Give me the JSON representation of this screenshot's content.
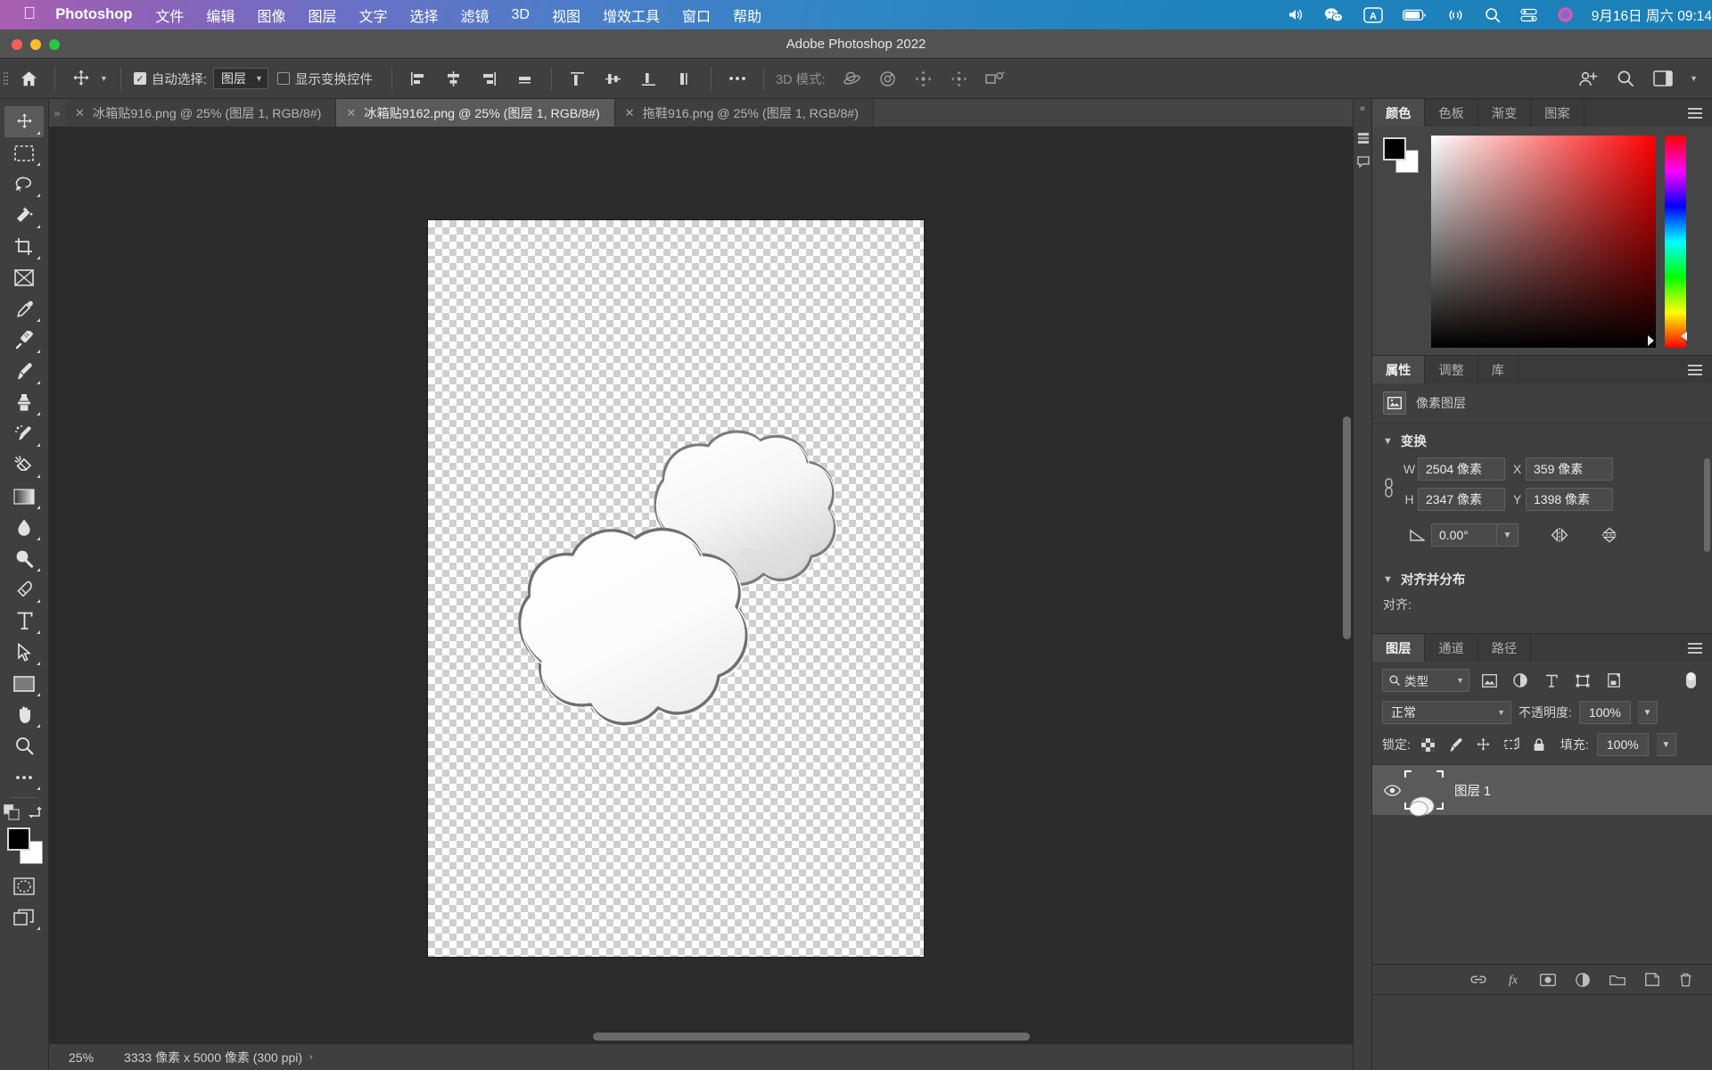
{
  "macbar": {
    "apple_icon": "apple-logo-icon",
    "app_name": "Photoshop",
    "menus": [
      "文件",
      "编辑",
      "图像",
      "图层",
      "文字",
      "选择",
      "滤镜",
      "3D",
      "视图",
      "增效工具",
      "窗口",
      "帮助"
    ],
    "tray_icons": [
      "volume-icon",
      "wechat-icon",
      "input-source-icon",
      "battery-icon",
      "link-icon",
      "search-icon",
      "control-center-icon",
      "siri-icon"
    ],
    "clock": "9月16日 周六 09:14"
  },
  "window": {
    "title": "Adobe Photoshop 2022",
    "traffic": {
      "close": "#ff5f57",
      "minimize": "#febc2e",
      "zoom": "#28c840"
    }
  },
  "options_bar": {
    "home_icon": "home-icon",
    "tool_icon": "move-tool-icon",
    "auto_select": {
      "checked": true,
      "label": "自动选择:",
      "value": "图层"
    },
    "show_transform": {
      "checked": false,
      "label": "显示变换控件"
    },
    "align_icons": [
      "align-left-icon",
      "align-horizontal-center-icon",
      "align-right-icon",
      "distribute-horizontal-icon",
      "align-top-icon",
      "align-vertical-center-icon",
      "align-bottom-icon",
      "distribute-vertical-icon"
    ],
    "more_icon": "more-options-icon",
    "mode3d_label": "3D 模式:",
    "mode3d_icons": [
      "orbit-3d-icon",
      "roll-3d-icon",
      "pan-3d-icon",
      "slide-3d-icon",
      "scale-3d-icon"
    ],
    "right_icons": [
      "share-icon",
      "search-icon",
      "workspace-icon",
      "chevron-down-icon"
    ]
  },
  "tabs": [
    {
      "label": "冰箱贴916.png @ 25% (图层 1, RGB/8#)",
      "active": false
    },
    {
      "label": "冰箱贴9162.png @ 25% (图层 1, RGB/8#)",
      "active": true
    },
    {
      "label": "拖鞋916.png @ 25% (图层 1, RGB/8#)",
      "active": false
    }
  ],
  "toolbar": {
    "tools": [
      {
        "name": "move-tool-icon",
        "selected": true,
        "arrow": true
      },
      {
        "name": "rectangular-marquee-tool-icon",
        "selected": false,
        "arrow": true
      },
      {
        "name": "lasso-tool-icon",
        "selected": false,
        "arrow": true
      },
      {
        "name": "magic-wand-tool-icon",
        "selected": false,
        "arrow": true
      },
      {
        "name": "crop-tool-icon",
        "selected": false,
        "arrow": true
      },
      {
        "name": "frame-tool-icon",
        "selected": false,
        "arrow": false
      },
      {
        "name": "eyedropper-tool-icon",
        "selected": false,
        "arrow": true
      },
      {
        "name": "spot-healing-brush-tool-icon",
        "selected": false,
        "arrow": true
      },
      {
        "name": "brush-tool-icon",
        "selected": false,
        "arrow": true
      },
      {
        "name": "clone-stamp-tool-icon",
        "selected": false,
        "arrow": true
      },
      {
        "name": "history-brush-tool-icon",
        "selected": false,
        "arrow": true
      },
      {
        "name": "eraser-tool-icon",
        "selected": false,
        "arrow": true
      },
      {
        "name": "gradient-tool-icon",
        "selected": false,
        "arrow": true
      },
      {
        "name": "blur-tool-icon",
        "selected": false,
        "arrow": true
      },
      {
        "name": "dodge-tool-icon",
        "selected": false,
        "arrow": true
      },
      {
        "name": "pen-tool-icon",
        "selected": false,
        "arrow": true
      },
      {
        "name": "type-tool-icon",
        "selected": false,
        "arrow": true
      },
      {
        "name": "path-selection-tool-icon",
        "selected": false,
        "arrow": true
      },
      {
        "name": "rectangle-tool-icon",
        "selected": false,
        "arrow": true
      },
      {
        "name": "hand-tool-icon",
        "selected": false,
        "arrow": true
      },
      {
        "name": "zoom-tool-icon",
        "selected": false,
        "arrow": false
      },
      {
        "name": "edit-toolbar-icon",
        "selected": false,
        "arrow": true
      }
    ],
    "swap_icons": [
      "default-colors-icon",
      "swap-colors-icon"
    ],
    "foreground_color": "#000000",
    "background_color": "#ffffff",
    "quick_mask_icon": "quick-mask-icon",
    "screen_mode_icon": "screen-mode-icon"
  },
  "status_bar": {
    "zoom": "25%",
    "doc_size": "3333 像素 x 5000 像素 (300 ppi)",
    "arrow": "›"
  },
  "dock": {
    "collapse_icon": "collapse-panels-icon",
    "rail_icons": [
      "history-panel-icon",
      "comments-panel-icon"
    ],
    "color_panel": {
      "tabs": [
        {
          "label": "颜色",
          "active": true
        },
        {
          "label": "色板",
          "active": false
        },
        {
          "label": "渐变",
          "active": false
        },
        {
          "label": "图案",
          "active": false
        }
      ],
      "menu_icon": "panel-menu-icon",
      "foreground_color": "#000000",
      "background_color": "#ffffff",
      "spectrum_hue": "#ff0000"
    },
    "properties_panel": {
      "tabs": [
        {
          "label": "属性",
          "active": true
        },
        {
          "label": "调整",
          "active": false
        },
        {
          "label": "库",
          "active": false
        }
      ],
      "menu_icon": "panel-menu-icon",
      "kind_icon": "pixel-layer-icon",
      "kind_label": "像素图层",
      "transform": {
        "section_label": "变换",
        "link_icon": "link-dimensions-icon",
        "w_label": "W",
        "w_value": "2504 像素",
        "x_label": "X",
        "x_value": "359 像素",
        "h_label": "H",
        "h_value": "2347 像素",
        "y_label": "Y",
        "y_value": "1398 像素",
        "angle_icon": "angle-icon",
        "angle_value": "0.00°",
        "flip_h_icon": "flip-horizontal-icon",
        "flip_v_icon": "flip-vertical-icon"
      },
      "align": {
        "section_label": "对齐并分布",
        "align_label": "对齐:"
      }
    },
    "layers_panel": {
      "tabs": [
        {
          "label": "图层",
          "active": true
        },
        {
          "label": "通道",
          "active": false
        },
        {
          "label": "路径",
          "active": false
        }
      ],
      "menu_icon": "panel-menu-icon",
      "filter": {
        "search_icon": "search-icon",
        "kind_label": "类型",
        "type_icons": [
          "filter-pixel-icon",
          "filter-adjustment-icon",
          "filter-type-icon",
          "filter-shape-icon",
          "filter-smart-object-icon"
        ],
        "toggle_icon": "filter-toggle-icon"
      },
      "blend_mode": "正常",
      "opacity_label": "不透明度:",
      "opacity_value": "100%",
      "lock_label": "锁定:",
      "lock_icons": [
        "lock-transparent-pixels-icon",
        "lock-image-pixels-icon",
        "lock-position-icon",
        "lock-artboard-nesting-icon",
        "lock-all-icon"
      ],
      "fill_label": "填充:",
      "fill_value": "100%",
      "layers": [
        {
          "name": "图层 1",
          "visible": true,
          "selected": true,
          "eye_icon": "eye-icon"
        }
      ],
      "footer_icons": [
        "link-layers-icon",
        "layer-style-icon",
        "layer-mask-icon",
        "adjustment-layer-icon",
        "new-group-icon",
        "new-layer-icon",
        "delete-layer-icon"
      ]
    }
  },
  "canvas": {
    "artwork_name": "cloud-shaped-fridge-magnet-artwork",
    "background": "transparent-checkerboard"
  }
}
